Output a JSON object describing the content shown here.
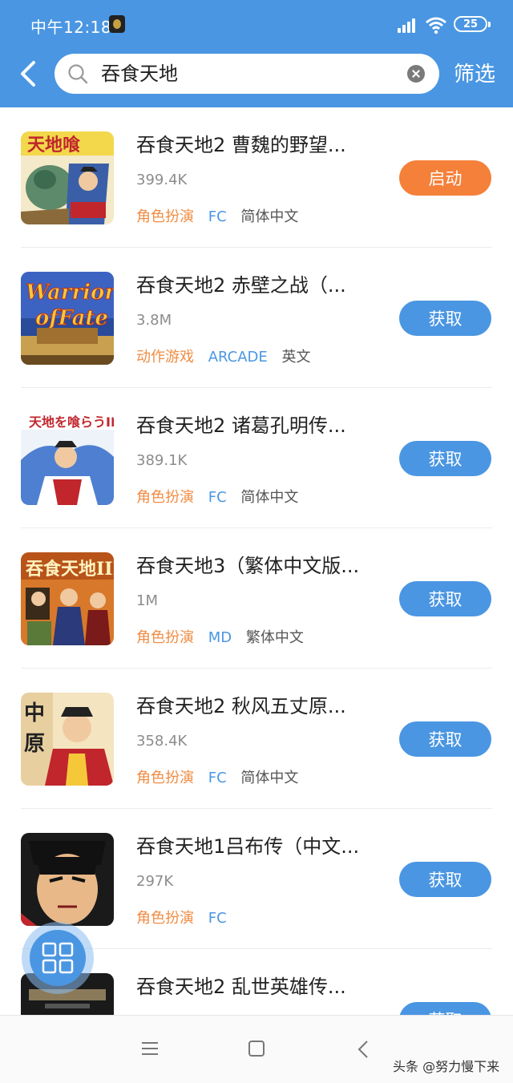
{
  "status_bar": {
    "time": "中午12:18",
    "battery": "25"
  },
  "header": {
    "search_value": "吞食天地",
    "filter_label": "筛选"
  },
  "items": [
    {
      "title": "吞食天地2 曹魏的野望...",
      "size": "399.4K",
      "genre": "角色扮演",
      "platform": "FC",
      "language": "简体中文",
      "action": "启动"
    },
    {
      "title": "吞食天地2 赤壁之战（...",
      "size": "3.8M",
      "genre": "动作游戏",
      "platform": "ARCADE",
      "language": "英文",
      "action": "获取"
    },
    {
      "title": "吞食天地2 诸葛孔明传...",
      "size": "389.1K",
      "genre": "角色扮演",
      "platform": "FC",
      "language": "简体中文",
      "action": "获取"
    },
    {
      "title": "吞食天地3（繁体中文版...",
      "size": "1M",
      "genre": "角色扮演",
      "platform": "MD",
      "language": "繁体中文",
      "action": "获取"
    },
    {
      "title": "吞食天地2 秋风五丈原...",
      "size": "358.4K",
      "genre": "角色扮演",
      "platform": "FC",
      "language": "简体中文",
      "action": "获取"
    },
    {
      "title": "吞食天地1吕布传（中文...",
      "size": "297K",
      "genre": "角色扮演",
      "platform": "FC",
      "language": "",
      "action": "获取"
    },
    {
      "title": "吞食天地2 乱世英雄传...",
      "size": "",
      "genre": "",
      "platform": "",
      "language": "",
      "action": "获取"
    }
  ],
  "watermark": "头条 @努力慢下来",
  "colors": {
    "primary": "#4a96e2",
    "launch": "#f5803a",
    "genre": "#f08c43"
  }
}
